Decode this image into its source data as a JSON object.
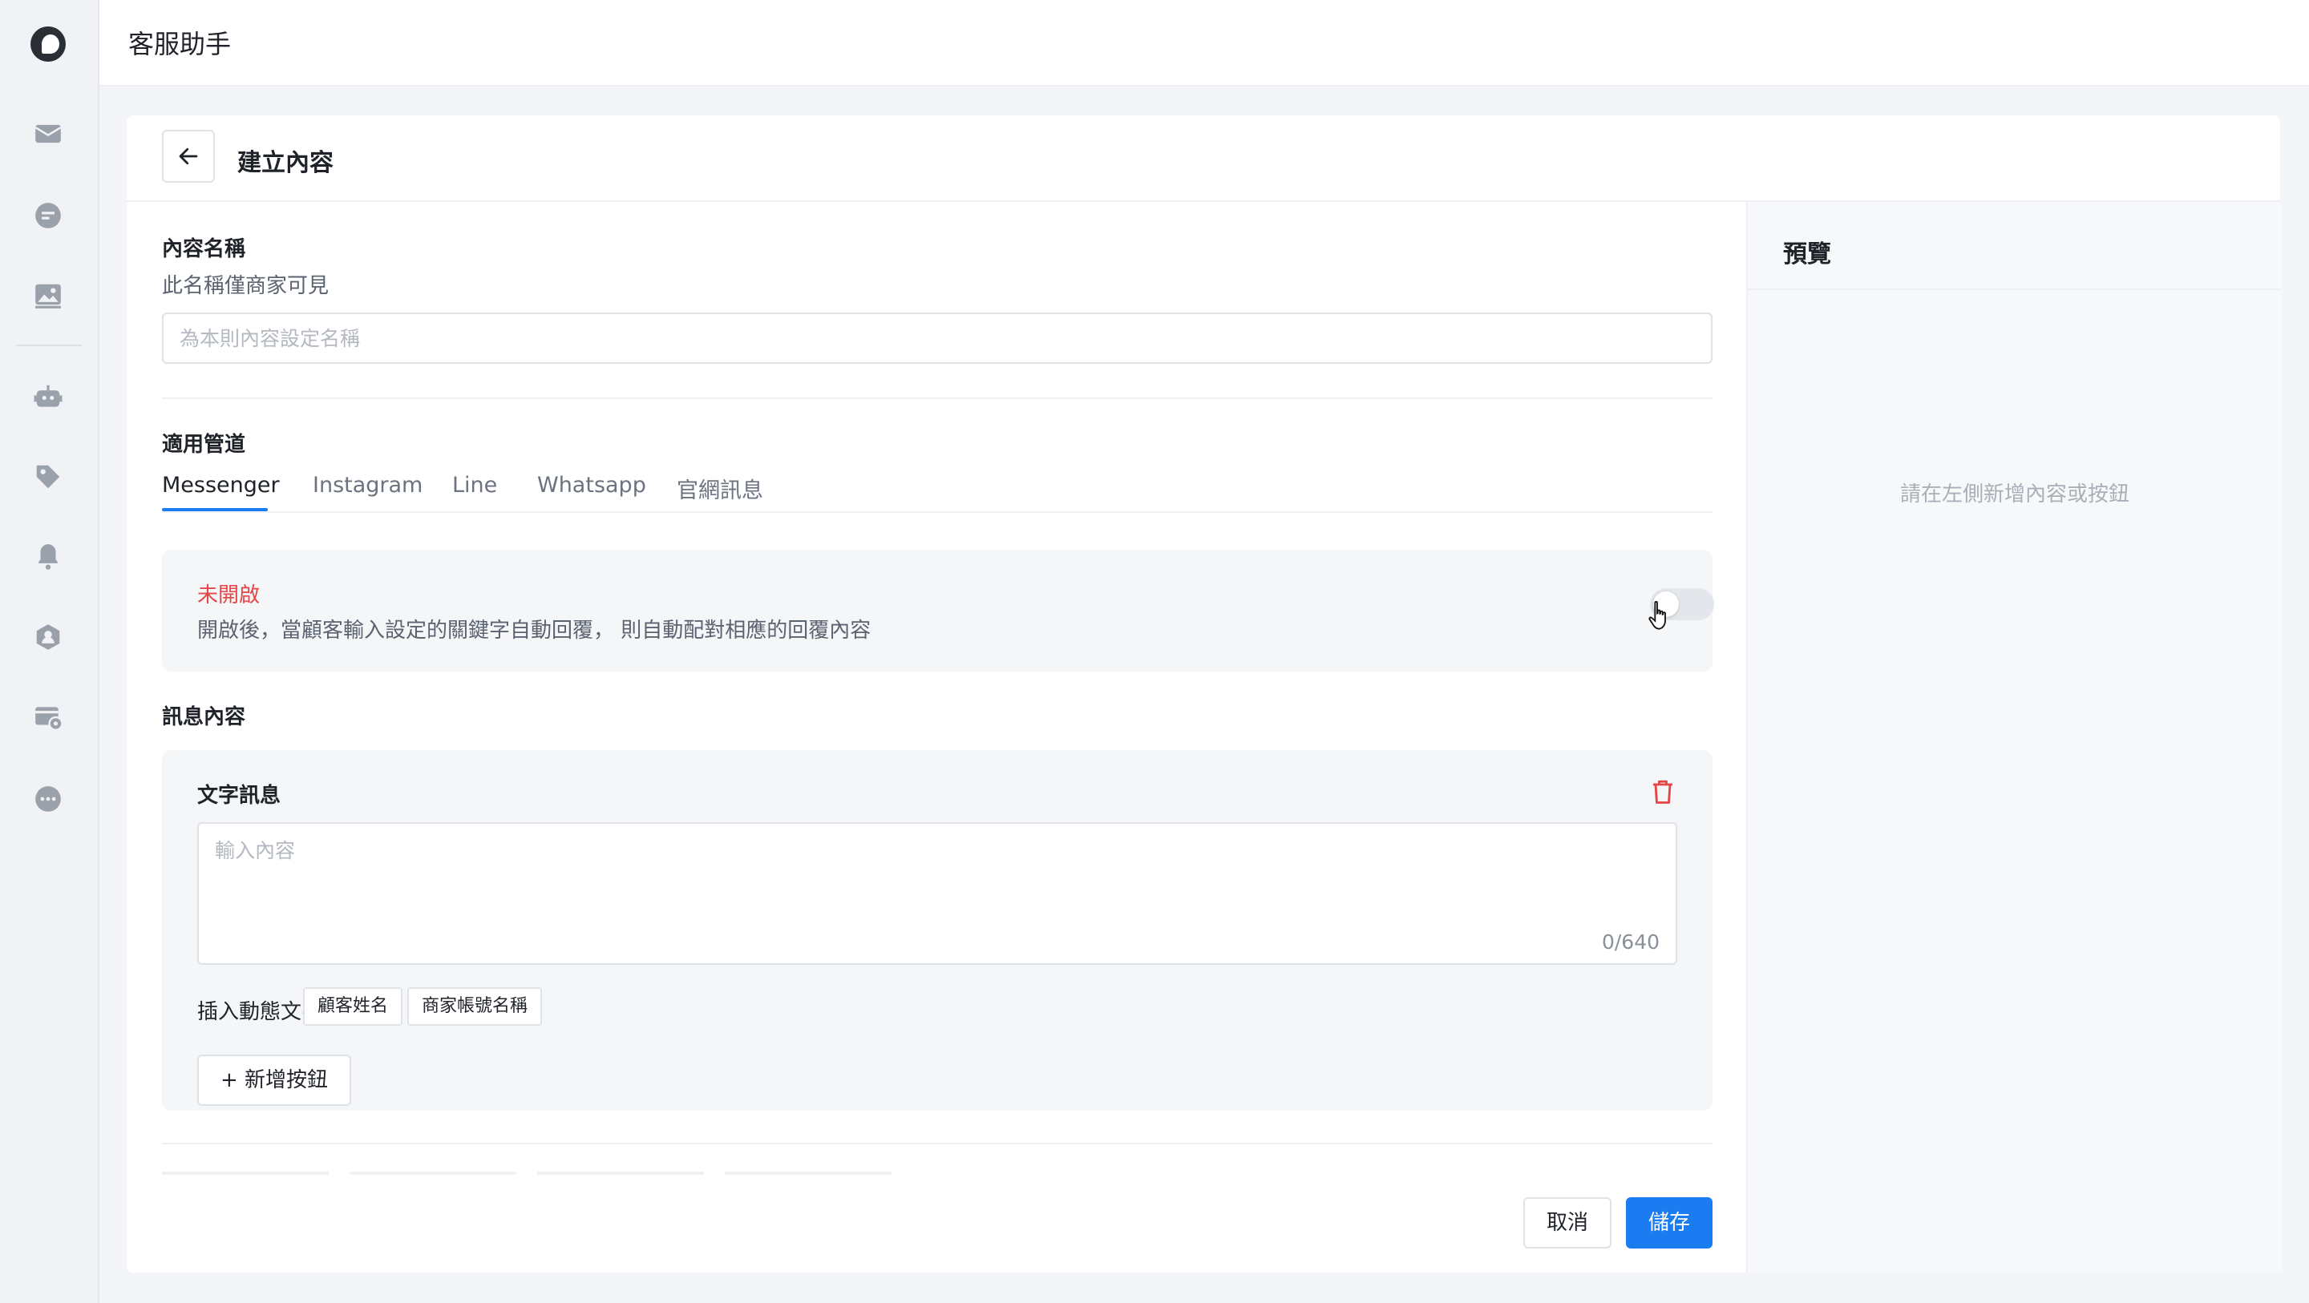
{
  "app": {
    "title": "客服助手"
  },
  "sidebar": {
    "logo": "parrot-logo-icon",
    "items": [
      {
        "name": "inbox",
        "icon": "mail-icon"
      },
      {
        "name": "chat",
        "icon": "chat-bubble-icon"
      },
      {
        "name": "media",
        "icon": "image-icon"
      },
      {
        "name": "bot",
        "icon": "robot-icon"
      },
      {
        "name": "tags",
        "icon": "tag-icon"
      },
      {
        "name": "notifications",
        "icon": "bell-icon"
      },
      {
        "name": "contacts",
        "icon": "user-badge-icon"
      },
      {
        "name": "settings-card",
        "icon": "card-gear-icon"
      },
      {
        "name": "more",
        "icon": "more-dots-icon"
      }
    ]
  },
  "page": {
    "title": "建立內容"
  },
  "form": {
    "name_label": "內容名稱",
    "name_hint": "此名稱僅商家可見",
    "name_value": "",
    "name_placeholder": "為本則內容設定名稱",
    "channel_label": "適用管道",
    "channel_tabs": [
      "Messenger",
      "Instagram",
      "Line",
      "Whatsapp",
      "官網訊息"
    ],
    "active_tab": "Messenger",
    "status_text": "未開啟",
    "status_description": "開啟後，當顧客輸入設定的關鍵字自動回覆， 則自動配對相應的回覆內容",
    "toggle_on": false,
    "message_label": "訊息內容",
    "message_card": {
      "title": "文字訊息",
      "placeholder": "輸入內容",
      "count": "0/640",
      "insert_label": "插入動態文字:",
      "chips": [
        "顧客姓名",
        "商家帳號名稱"
      ],
      "add_button": "+ 新增按鈕"
    }
  },
  "preview": {
    "title": "預覽",
    "empty_text": "請在左側新增內容或按鈕"
  },
  "actions": {
    "cancel": "取消",
    "save": "儲存"
  },
  "colors": {
    "accent": "#1a7cf0",
    "danger": "#e54545",
    "panel_bg": "#f5f6f8"
  }
}
